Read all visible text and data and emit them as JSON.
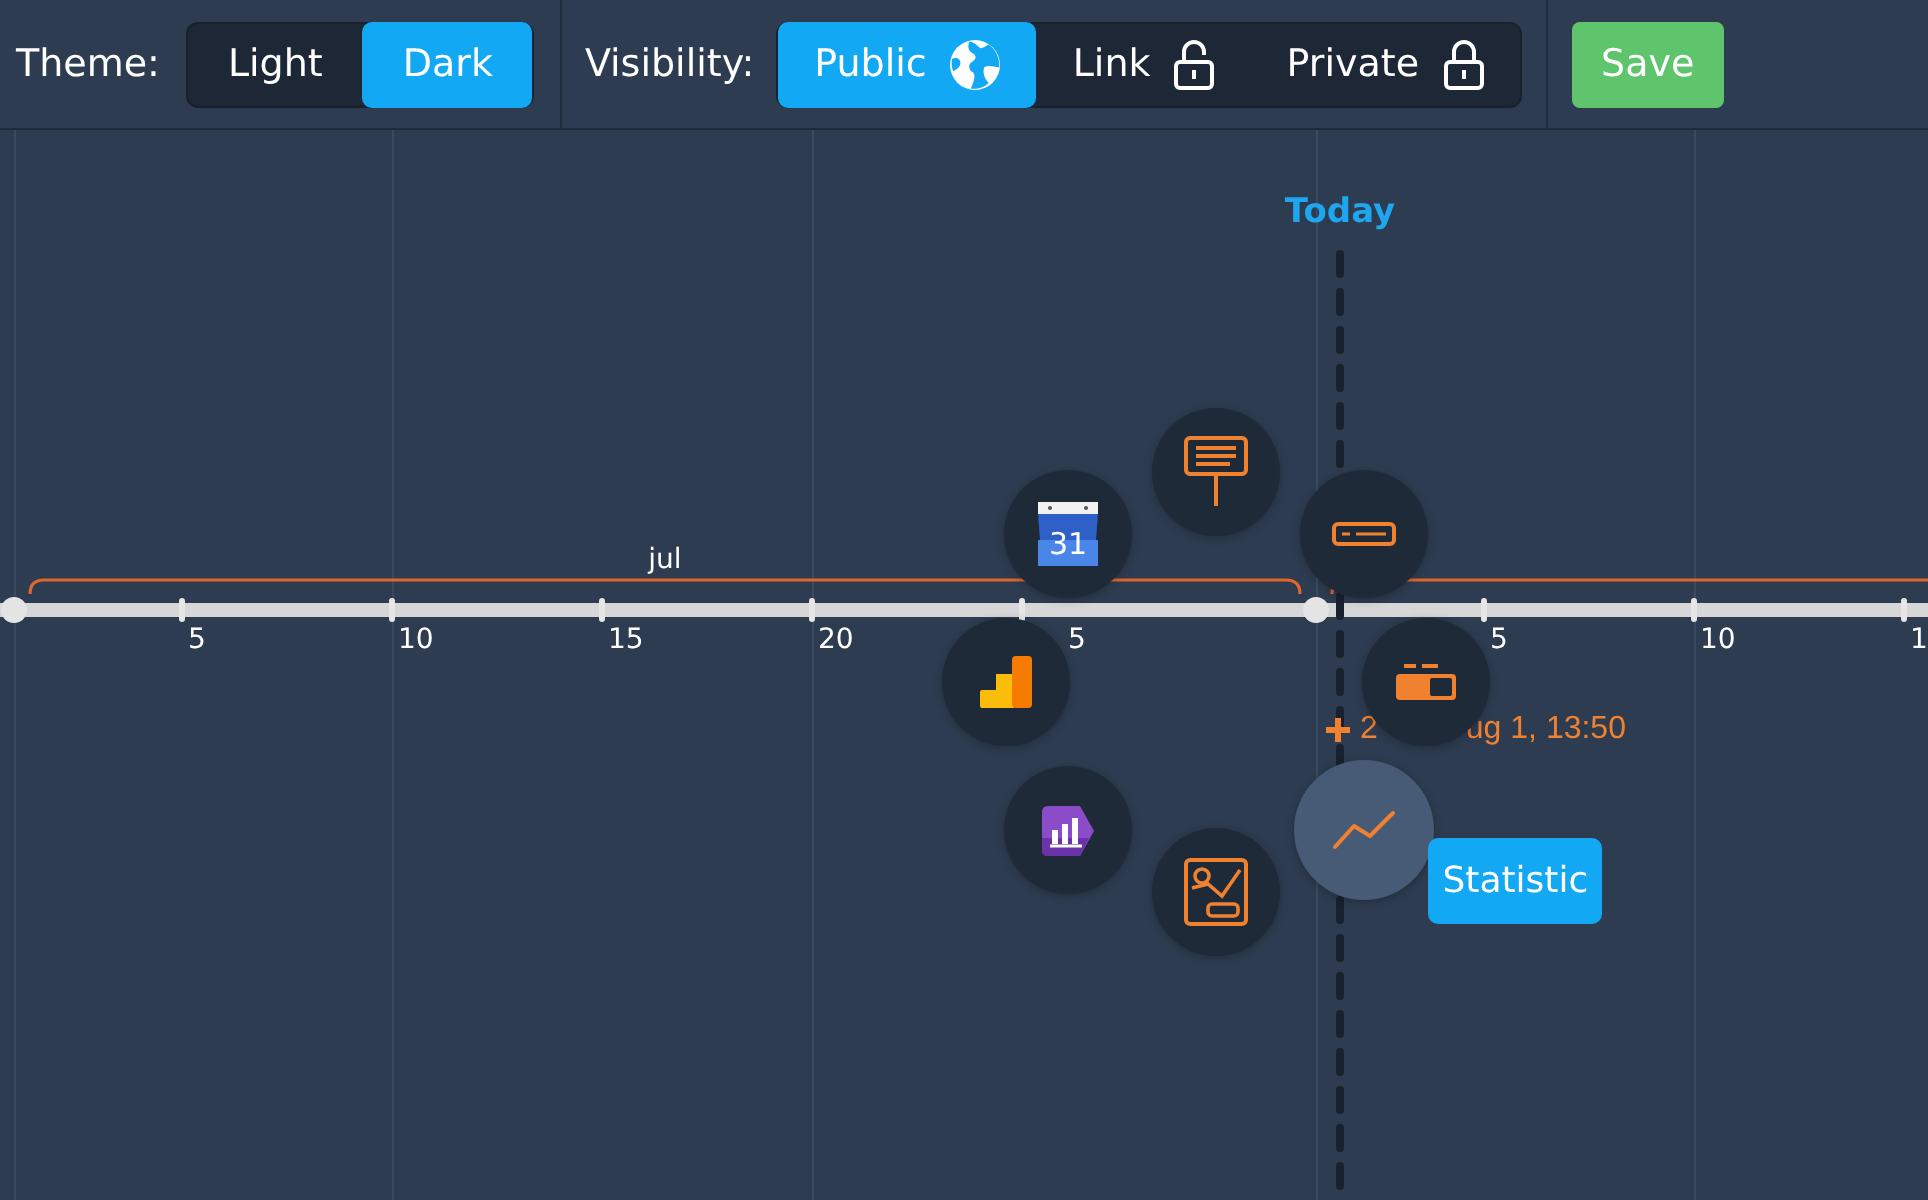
{
  "toolbar": {
    "theme": {
      "label": "Theme:",
      "options": [
        {
          "label": "Light",
          "selected": false
        },
        {
          "label": "Dark",
          "selected": true
        }
      ]
    },
    "visibility": {
      "label": "Visibility:",
      "options": [
        {
          "label": "Public",
          "kind": "globe",
          "selected": true
        },
        {
          "label": "Link",
          "kind": "unlocked",
          "selected": false
        },
        {
          "label": "Private",
          "kind": "locked",
          "selected": false
        }
      ]
    },
    "save_button": "Save"
  },
  "timeline": {
    "today_label": "Today",
    "months": [
      {
        "label": "jul",
        "ticks": [
          {
            "label": "5",
            "kind": "plain"
          },
          {
            "label": "10",
            "kind": "plain"
          },
          {
            "label": "15",
            "kind": "plain"
          },
          {
            "label": "20",
            "kind": "plain"
          },
          {
            "label": "5",
            "kind": "covered"
          }
        ]
      },
      {
        "ticks": [
          {
            "label": "5",
            "kind": "plain"
          },
          {
            "label": "10",
            "kind": "plain"
          },
          {
            "label": "1",
            "kind": "plain"
          }
        ]
      }
    ],
    "event_marker": {
      "date_parts": [
        "2",
        "ug 1, 13:50"
      ]
    },
    "radial_menu": {
      "items": [
        {
          "kind": "signboard",
          "selected": false
        },
        {
          "kind": "text-field",
          "selected": false
        },
        {
          "kind": "progress",
          "selected": false
        },
        {
          "kind": "line-chart",
          "selected": true
        },
        {
          "kind": "chart-card",
          "selected": false
        },
        {
          "kind": "tag-chart",
          "selected": false
        },
        {
          "kind": "bar-chart",
          "selected": false
        },
        {
          "kind": "calendar",
          "icon_text": "31",
          "selected": false
        }
      ],
      "tooltip": "Statistic"
    }
  }
}
